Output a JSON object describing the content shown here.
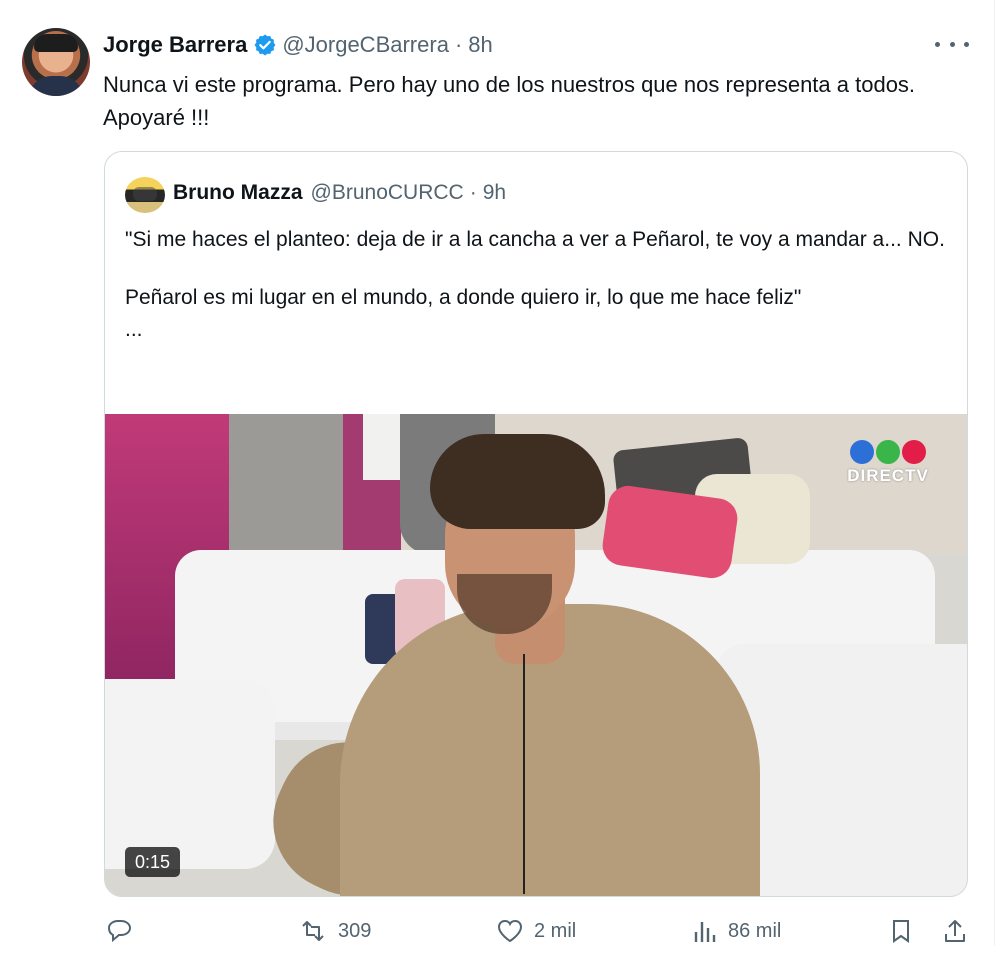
{
  "author": {
    "name": "Jorge Barrera",
    "handle": "@JorgeCBarrera",
    "separator": "·",
    "time": "8h",
    "text": "Nunca vi este programa.  Pero hay uno de los nuestros que nos representa a todos.  Apoyaré !!!"
  },
  "quote": {
    "name": "Bruno Mazza",
    "handle": "@BrunoCURCC",
    "separator": "·",
    "time": "9h",
    "paragraph1": "\"Si me haces el planteo: deja de ir a la cancha a ver a Peñarol, te voy a mandar a... NO.",
    "paragraph2": "Peñarol es mi lugar en el mundo, a donde quiero ir, lo que me hace feliz\"",
    "ellipsis": "...",
    "video_duration": "0:15",
    "watermark": "DIRECTV",
    "watermark_colors": [
      "#2c6fd6",
      "#39b54a",
      "#e11d48"
    ]
  },
  "actions": {
    "reposts": "309",
    "likes": "2 mil",
    "views": "86 mil"
  },
  "icons": [
    "verified-icon",
    "more-icon",
    "reply-icon",
    "repost-icon",
    "like-icon",
    "views-icon",
    "bookmark-icon",
    "share-icon"
  ],
  "colors": {
    "verified": "#1d9bf0",
    "secondary_text": "#536471",
    "border": "#cfd9de"
  }
}
